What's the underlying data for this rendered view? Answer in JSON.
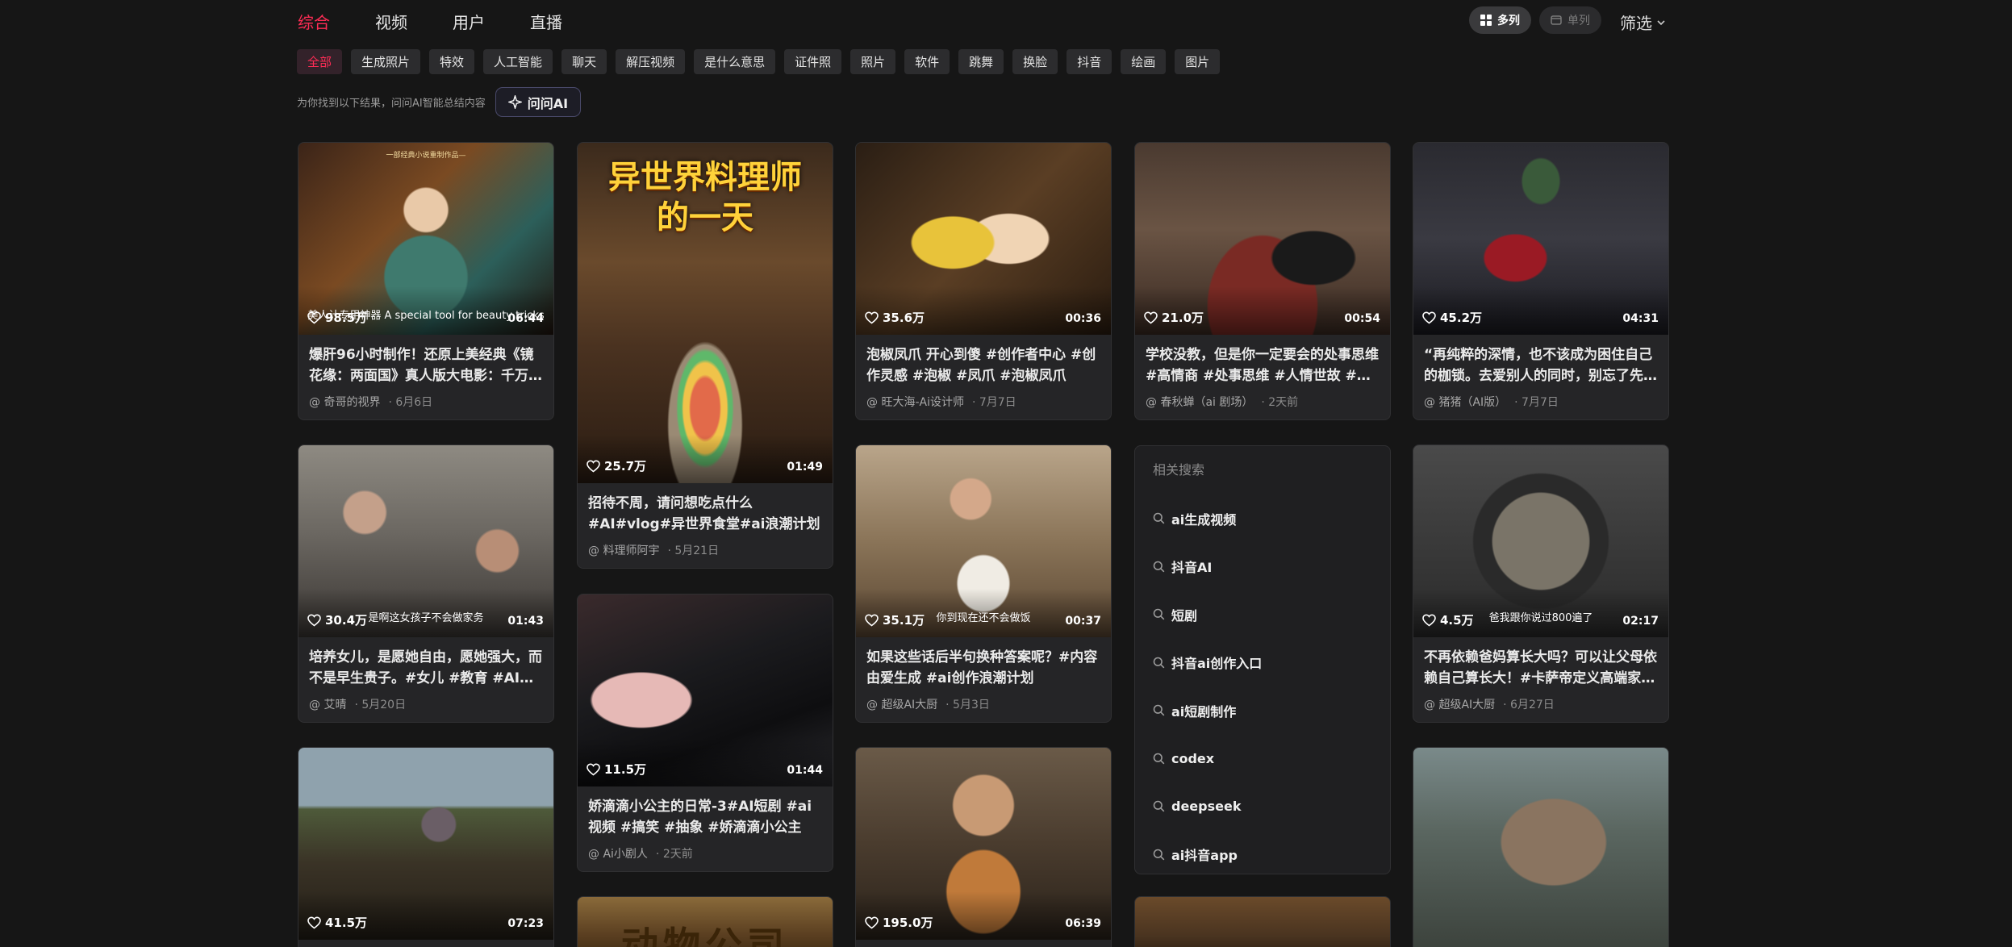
{
  "nav": {
    "tabs": [
      {
        "label": "综合"
      },
      {
        "label": "视频"
      },
      {
        "label": "用户"
      },
      {
        "label": "直播"
      }
    ],
    "view_multi": "多列",
    "view_single": "单列",
    "filter": "筛选"
  },
  "chips": [
    "全部",
    "生成照片",
    "特效",
    "人工智能",
    "聊天",
    "解压视频",
    "是什么意思",
    "证件照",
    "照片",
    "软件",
    "跳舞",
    "换脸",
    "抖音",
    "绘画",
    "图片"
  ],
  "ai": {
    "note": "为你找到以下结果，问问AI智能总结内容",
    "button": "问问AI"
  },
  "cards": [
    {
      "likes": "98.5万",
      "duration": "06:44",
      "subtitle": "美人计专用神器 A special tool for beauty tricks",
      "title": "爆肝96小时制作！还原上美经典《镜花缘：两面国》真人版大电影：千万别…",
      "author": "@ 奇哥的视界",
      "date": "· 6月6日"
    },
    {
      "likes": "25.7万",
      "duration": "01:49",
      "subtitle": "",
      "title": "招待不周，请问想吃点什么#AI#vlog#异世界食堂#ai浪潮计划",
      "author": "@ 料理师阿宇",
      "date": "· 5月21日"
    },
    {
      "likes": "35.6万",
      "duration": "00:36",
      "subtitle": "",
      "title": "泡椒凤爪 开心到傻 #创作者中心 #创作灵感 #泡椒 #凤爪 #泡椒凤爪",
      "author": "@ 旺大海-Ai设计师",
      "date": "· 7月7日"
    },
    {
      "likes": "21.0万",
      "duration": "00:54",
      "subtitle": "",
      "title": "学校没教，但是你一定要会的处事思维 #高情商 #处事思维 #人情世故 #ai短片",
      "author": "@ 春秋蝉（ai 剧场）",
      "date": "· 2天前"
    },
    {
      "likes": "45.2万",
      "duration": "04:31",
      "subtitle": "",
      "title": "“再纯粹的深情，也不该成为困住自己的枷锁。去爱别人的同时，别忘了先…",
      "author": "@ 猪猪（AI版）",
      "date": "· 7月7日"
    },
    {
      "likes": "30.4万",
      "duration": "01:43",
      "subtitle": "是啊这女孩子不会做家务",
      "title": "培养女儿，是愿她自由，愿她强大，而不是早生贵子。#女儿 #教育 #AI #ai…",
      "author": "@ 艾晴",
      "date": "· 5月20日"
    },
    {
      "likes": "11.5万",
      "duration": "01:44",
      "subtitle": "",
      "title": "娇滴滴小公主的日常-3#AI短剧 #ai视频 #搞笑 #抽象 #娇滴滴小公主",
      "author": "@ Ai小剧人",
      "date": "· 2天前"
    },
    {
      "likes": "35.1万",
      "duration": "00:37",
      "subtitle": "你到现在还不会做饭",
      "title": "如果这些话后半句换种答案呢？#内容由爱生成 #ai创作浪潮计划",
      "author": "@ 超级AI大厨",
      "date": "· 5月3日"
    },
    {
      "likes": "4.5万",
      "duration": "02:17",
      "subtitle": "爸我跟你说过800遍了",
      "title": "不再依赖爸妈算长大吗？可以让父母依赖自己算长大！#卡萨帝定义高端家…",
      "author": "@ 超级AI大厨",
      "date": "· 6月27日"
    },
    {
      "likes": "41.5万",
      "duration": "07:23"
    },
    {
      "likes": "195.0万",
      "duration": "06:39"
    },
    {},
    {},
    {}
  ],
  "thumb_texts": {
    "poster_title": "异世界料理师的一天",
    "movie_title": "动物公司",
    "mirror_caption": "一部经典小说重制作品—"
  },
  "related": {
    "head": "相关搜索",
    "items": [
      "ai生成视频",
      "抖音AI",
      "短剧",
      "抖音ai创作入口",
      "ai短剧制作",
      "codex",
      "deepseek",
      "ai抖音app"
    ]
  }
}
